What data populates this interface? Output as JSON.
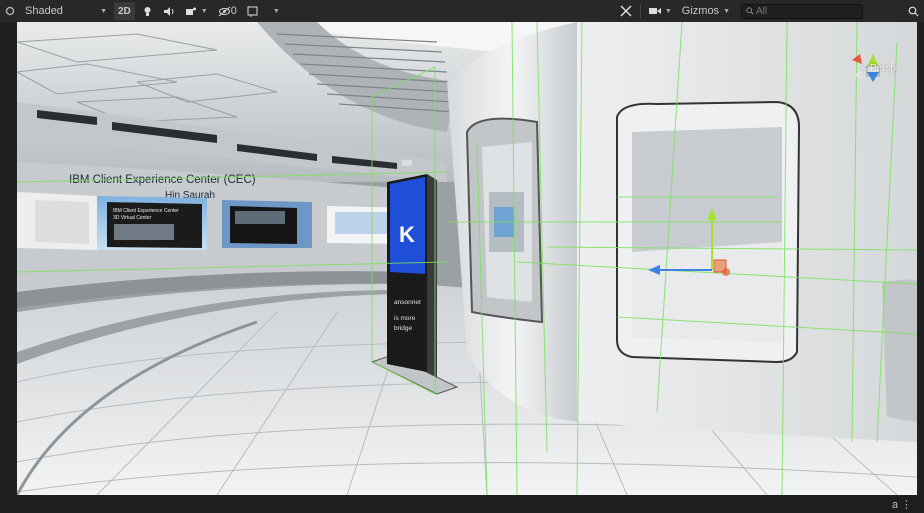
{
  "toolbar": {
    "draw_mode": "Shaded",
    "mode_2d": "2D",
    "hidden_count": "0",
    "gizmos_label": "Gizmos",
    "search_placeholder": "All"
  },
  "scene": {
    "banner_title": "IBM Client Experience Center (CEC)",
    "banner_subtitle": "Hin Saurah",
    "screen_text_1": "IBM Client Experience Center",
    "screen_text_2": "3D Virtual Center",
    "kiosk_logo": "K",
    "kiosk_line_1": "ansonnet",
    "kiosk_line_2": "is more",
    "kiosk_line_3": "bridge",
    "gizmo_projection": "< Persp"
  },
  "status": {
    "corner_glyph": "a ⋮"
  },
  "colors": {
    "toolbar_bg": "#282828",
    "kiosk_blue": "#1f4fd8",
    "selection_green": "#79e25a",
    "axis_x": "#e85a3a",
    "axis_y": "#a6e22e",
    "axis_z": "#3d82e0"
  }
}
